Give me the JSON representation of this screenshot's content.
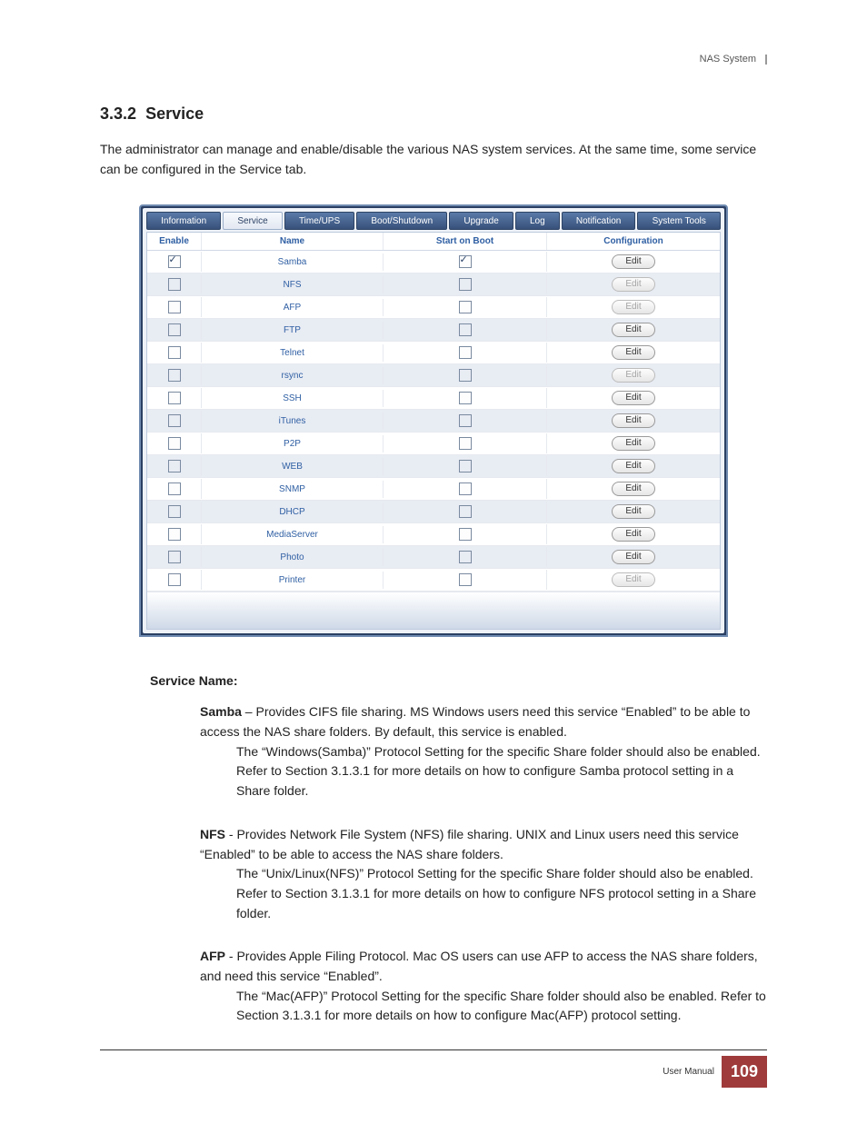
{
  "header": {
    "product": "NAS System"
  },
  "section": {
    "number": "3.3.2",
    "title": "Service"
  },
  "intro": "The administrator can manage and enable/disable the various NAS system services. At the same time, some service can be configured in the Service tab.",
  "tabs": [
    "Information",
    "Service",
    "Time/UPS",
    "Boot/Shutdown",
    "Upgrade",
    "Log",
    "Notification",
    "System Tools"
  ],
  "active_tab_index": 1,
  "columns": {
    "enable": "Enable",
    "name": "Name",
    "start": "Start on Boot",
    "conf": "Configuration"
  },
  "edit_label": "Edit",
  "services": [
    {
      "name": "Samba",
      "enable": true,
      "start": true,
      "edit_enabled": true
    },
    {
      "name": "NFS",
      "enable": false,
      "start": false,
      "edit_enabled": false
    },
    {
      "name": "AFP",
      "enable": false,
      "start": false,
      "edit_enabled": false
    },
    {
      "name": "FTP",
      "enable": false,
      "start": false,
      "edit_enabled": true
    },
    {
      "name": "Telnet",
      "enable": false,
      "start": false,
      "edit_enabled": true
    },
    {
      "name": "rsync",
      "enable": false,
      "start": false,
      "edit_enabled": false
    },
    {
      "name": "SSH",
      "enable": false,
      "start": false,
      "edit_enabled": true
    },
    {
      "name": "iTunes",
      "enable": false,
      "start": false,
      "edit_enabled": true
    },
    {
      "name": "P2P",
      "enable": false,
      "start": false,
      "edit_enabled": true
    },
    {
      "name": "WEB",
      "enable": false,
      "start": false,
      "edit_enabled": true
    },
    {
      "name": "SNMP",
      "enable": false,
      "start": false,
      "edit_enabled": true
    },
    {
      "name": "DHCP",
      "enable": false,
      "start": false,
      "edit_enabled": true
    },
    {
      "name": "MediaServer",
      "enable": false,
      "start": false,
      "edit_enabled": true
    },
    {
      "name": "Photo",
      "enable": false,
      "start": false,
      "edit_enabled": true
    },
    {
      "name": "Printer",
      "enable": false,
      "start": false,
      "edit_enabled": false
    }
  ],
  "service_name_label": "Service Name:",
  "descriptions": [
    {
      "name": "Samba",
      "sep": " – ",
      "first": "Provides CIFS file sharing. MS Windows users need this service “Enabled” to be able to access the NAS share folders. By default, this service is enabled.",
      "rest": "The “Windows(Samba)” Protocol Setting for the specific Share folder should also be enabled. Refer to Section 3.1.3.1 for more details on how to configure Samba protocol setting in a Share folder."
    },
    {
      "name": "NFS",
      "sep": " - ",
      "first": "Provides Network File System (NFS) file sharing. UNIX and Linux users need this service “Enabled” to be able to access the NAS share folders.",
      "rest": "The “Unix/Linux(NFS)” Protocol Setting for the specific Share folder should also be enabled. Refer to Section 3.1.3.1 for more details on how to configure NFS protocol setting in a Share folder."
    },
    {
      "name": "AFP",
      "sep": " - ",
      "first": "Provides Apple Filing Protocol. Mac OS users can use AFP to access the NAS share folders, and need this service “Enabled”.",
      "rest": "The “Mac(AFP)” Protocol Setting for the specific Share folder should also be enabled. Refer to Section 3.1.3.1 for more details on how to configure Mac(AFP) protocol setting."
    }
  ],
  "footer": {
    "label": "User Manual",
    "page": "109"
  }
}
